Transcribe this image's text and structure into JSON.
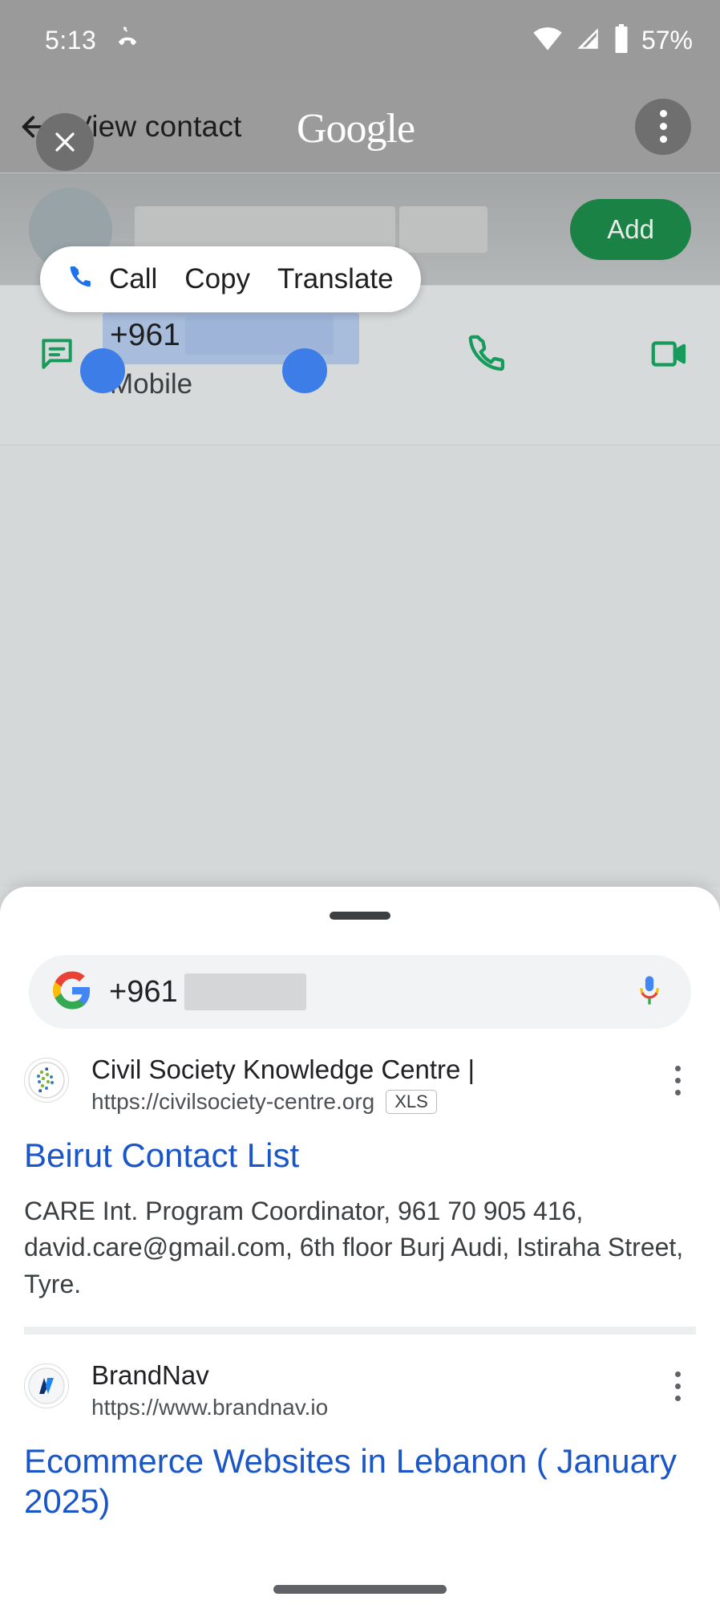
{
  "status_bar": {
    "time": "5:13",
    "missed_call_icon": "missed-call-icon",
    "wifi_icon": "wifi-icon",
    "signal_icon": "cell-signal-icon",
    "battery_icon": "battery-icon",
    "battery_text": "57%"
  },
  "contacts_app": {
    "toolbar": {
      "back_icon": "back-arrow-icon",
      "title": "View contact",
      "overflow_icon": "more-vertical-icon"
    },
    "contact": {
      "avatar": "contact-avatar",
      "name_redacted": true,
      "add_label": "Add"
    },
    "phone_row": {
      "message_icon": "message-icon",
      "number_prefix": "+961",
      "number_redacted": true,
      "label": "Mobile",
      "call_icon": "phone-call-icon",
      "video_icon": "video-call-icon"
    }
  },
  "selection_popup": {
    "items": [
      {
        "label": "Call",
        "icon": "phone-blue-icon"
      },
      {
        "label": "Copy",
        "icon": ""
      },
      {
        "label": "Translate",
        "icon": ""
      }
    ]
  },
  "google_overlay": {
    "wordmark": "Google",
    "close_icon": "close-icon"
  },
  "sheet": {
    "grabber": "drag-handle",
    "search": {
      "google_logo": "google-g-icon",
      "query_prefix": "+961",
      "query_redacted": true,
      "mic_icon": "microphone-icon"
    },
    "results": [
      {
        "favicon": "civilsociety-favicon",
        "site_name": "Civil Society Knowledge Centre |",
        "url": "https://civilsociety-centre.org",
        "badge": "XLS",
        "title": "Beirut Contact List",
        "snippet": "CARE Int. Program Coordinator, 961 70 905 416, david.care@gmail.com, 6th floor Burj Audi, Istiraha Street, Tyre.",
        "overflow_icon": "more-vertical-icon"
      },
      {
        "favicon": "brandnav-favicon",
        "site_name": "BrandNav",
        "url": "https://www.brandnav.io",
        "badge": "",
        "title": "Ecommerce Websites in Lebanon ( January 2025)",
        "snippet": "",
        "overflow_icon": "more-vertical-icon"
      }
    ]
  },
  "system_nav": {
    "pill": "home-gesture-pill"
  },
  "colors": {
    "add_button_green": "#1a8245",
    "link_blue": "#1a56c5",
    "icon_green": "#169b5c",
    "selection_blue": "#3d7de8"
  }
}
